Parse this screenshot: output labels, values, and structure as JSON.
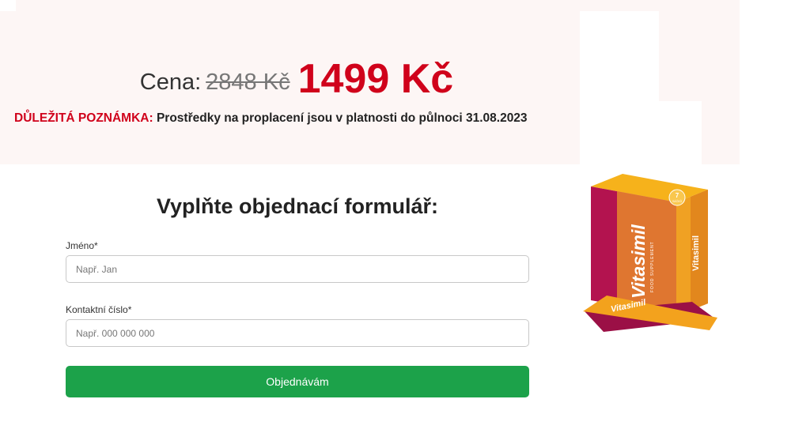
{
  "price": {
    "label": "Cena:",
    "old": "2848 Kč",
    "new": "1499 Kč"
  },
  "notice": {
    "label": "DŮLEŽITÁ POZNÁMKA:",
    "text": "Prostředky na proplacení jsou v platnosti do půlnoci 31.08.2023"
  },
  "form": {
    "title": "Vyplňte objednací formulář:",
    "name_label": "Jméno*",
    "name_placeholder": "Např. Jan",
    "name_value": "",
    "phone_label": "Kontaktní číslo*",
    "phone_placeholder": "Např. 000 000 000",
    "phone_value": "",
    "submit_label": "Objednávám"
  },
  "product": {
    "brand": "Vitasimil",
    "subtitle": "FOOD SUPPLEMENT",
    "badge_number": "7",
    "badge_text": "SÁČKŮ"
  },
  "colors": {
    "accent_red": "#d0021b",
    "button_green": "#1ca24a",
    "band_background": "#fdf6f5"
  }
}
